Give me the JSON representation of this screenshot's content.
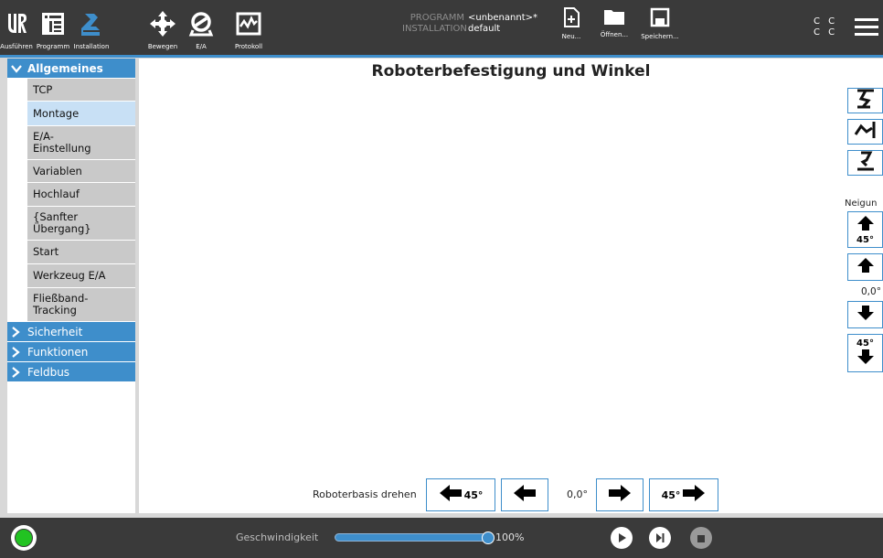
{
  "header": {
    "tabs": [
      {
        "label": "Ausführen",
        "icon": "ur-logo-icon"
      },
      {
        "label": "Programm",
        "icon": "program-icon"
      },
      {
        "label": "Installation",
        "icon": "installation-icon"
      },
      {
        "label": "Bewegen",
        "icon": "move-icon"
      },
      {
        "label": "E/A",
        "icon": "io-icon"
      },
      {
        "label": "Protokoll",
        "icon": "log-icon"
      }
    ],
    "program_key": "PROGRAMM",
    "program_value": "<unbenannt>*",
    "installation_key": "INSTALLATION",
    "installation_value": "default",
    "file_buttons": [
      {
        "label": "Neu...",
        "icon": "new-file-icon"
      },
      {
        "label": "Öffnen...",
        "icon": "folder-icon"
      },
      {
        "label": "Speichern...",
        "icon": "save-icon"
      }
    ],
    "cc_line1": "C C",
    "cc_line2": "C C",
    "menu_icon": "hamburger-menu-icon"
  },
  "sidebar": {
    "sections": [
      {
        "label": "Allgemeines",
        "expanded": true,
        "items": [
          "TCP",
          "Montage",
          "E/A-\nEinstellung",
          "Variablen",
          "Hochlauf",
          "{Sanfter\nÜbergang}",
          "Start",
          "Werkzeug E/A",
          "Fließband-\nTracking"
        ],
        "selected": "Montage"
      },
      {
        "label": "Sicherheit",
        "expanded": false
      },
      {
        "label": "Funktionen",
        "expanded": false
      },
      {
        "label": "Feldbus",
        "expanded": false
      }
    ]
  },
  "main": {
    "title": "Roboterbefestigung und Winkel",
    "tilt_label": "Neigun",
    "tilt_up_45": "45°",
    "tilt_value": "0,0°",
    "tilt_down_45": "45°",
    "rotate_label": "Roboterbasis drehen",
    "rotate_left_45": "45°",
    "rotate_value": "0,0°",
    "rotate_right_45": "45°"
  },
  "footer": {
    "speed_label": "Geschwindigkeit",
    "speed_value": "100%",
    "speed_fraction": 1.0,
    "status_color": "#22c322"
  },
  "colors": {
    "accent": "#3e8ecb",
    "header_bg": "#3a3a3a",
    "selected_item": "#c8e0f5"
  }
}
